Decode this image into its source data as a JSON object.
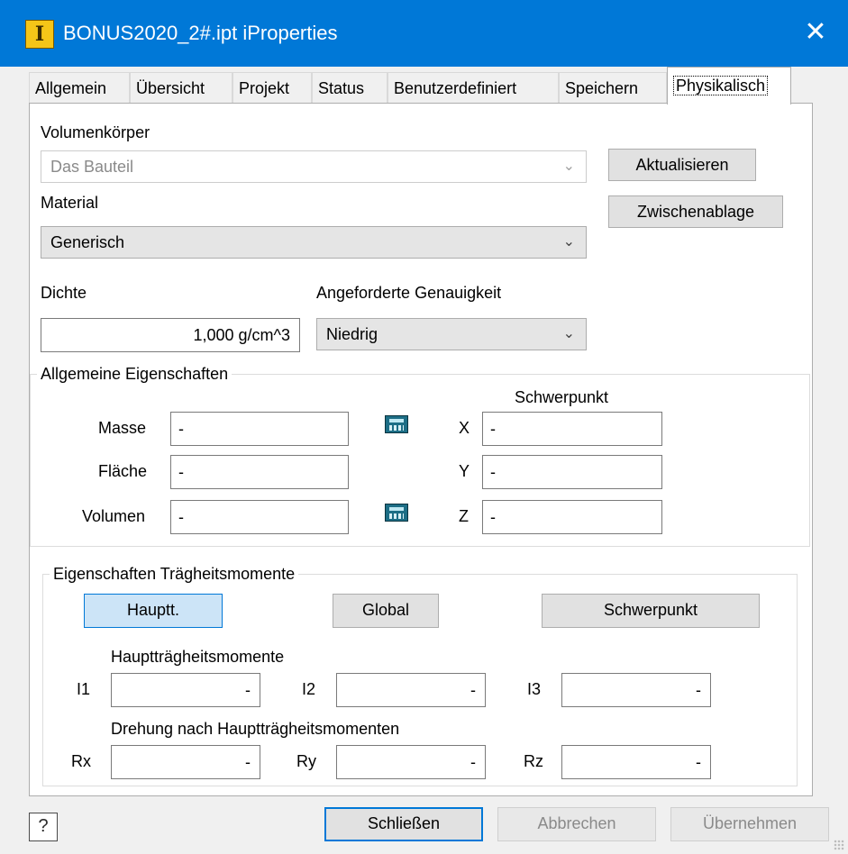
{
  "window": {
    "title": "BONUS2020_2#.ipt iProperties",
    "app_icon_glyph": "I",
    "close_glyph": "✕"
  },
  "tabs": [
    {
      "label": "Allgemein"
    },
    {
      "label": "Übersicht"
    },
    {
      "label": "Projekt"
    },
    {
      "label": "Status"
    },
    {
      "label": "Benutzerdefiniert"
    },
    {
      "label": "Speichern"
    },
    {
      "label": "Physikalisch",
      "active": true
    }
  ],
  "physical": {
    "solid": {
      "label": "Volumenkörper",
      "value": "Das Bauteil"
    },
    "material": {
      "label": "Material",
      "value": "Generisch"
    },
    "density": {
      "label": "Dichte",
      "value": "1,000 g/cm^3"
    },
    "accuracy": {
      "label": "Angeforderte Genauigkeit",
      "value": "Niedrig"
    },
    "update_button": "Aktualisieren",
    "clipboard_button": "Zwischenablage"
  },
  "general_properties": {
    "title": "Allgemeine Eigenschaften",
    "cog_heading": "Schwerpunkt",
    "mass": {
      "label": "Masse",
      "value": "-"
    },
    "area": {
      "label": "Fläche",
      "value": "-"
    },
    "volume": {
      "label": "Volumen",
      "value": "-"
    },
    "x": {
      "label": "X",
      "value": "-"
    },
    "y": {
      "label": "Y",
      "value": "-"
    },
    "z": {
      "label": "Z",
      "value": "-"
    }
  },
  "inertia": {
    "title": "Eigenschaften Trägheitsmomente",
    "buttons": {
      "principal": "Hauptt.",
      "global": "Global",
      "cog": "Schwerpunkt"
    },
    "principal_heading": "Hauptträgheitsmomente",
    "i1": {
      "label": "I1",
      "value": "-"
    },
    "i2": {
      "label": "I2",
      "value": "-"
    },
    "i3": {
      "label": "I3",
      "value": "-"
    },
    "rotation_heading": "Drehung nach Hauptträgheitsmomenten",
    "rx": {
      "label": "Rx",
      "value": "-"
    },
    "ry": {
      "label": "Ry",
      "value": "-"
    },
    "rz": {
      "label": "Rz",
      "value": "-"
    }
  },
  "footer": {
    "help_glyph": "?",
    "close_button": "Schließen",
    "cancel_button": "Abbrechen",
    "apply_button": "Übernehmen"
  },
  "icons": [
    "app-icon",
    "close-icon",
    "chevron-down-icon",
    "calculator-icon",
    "help-icon",
    "resize-grip-icon"
  ]
}
